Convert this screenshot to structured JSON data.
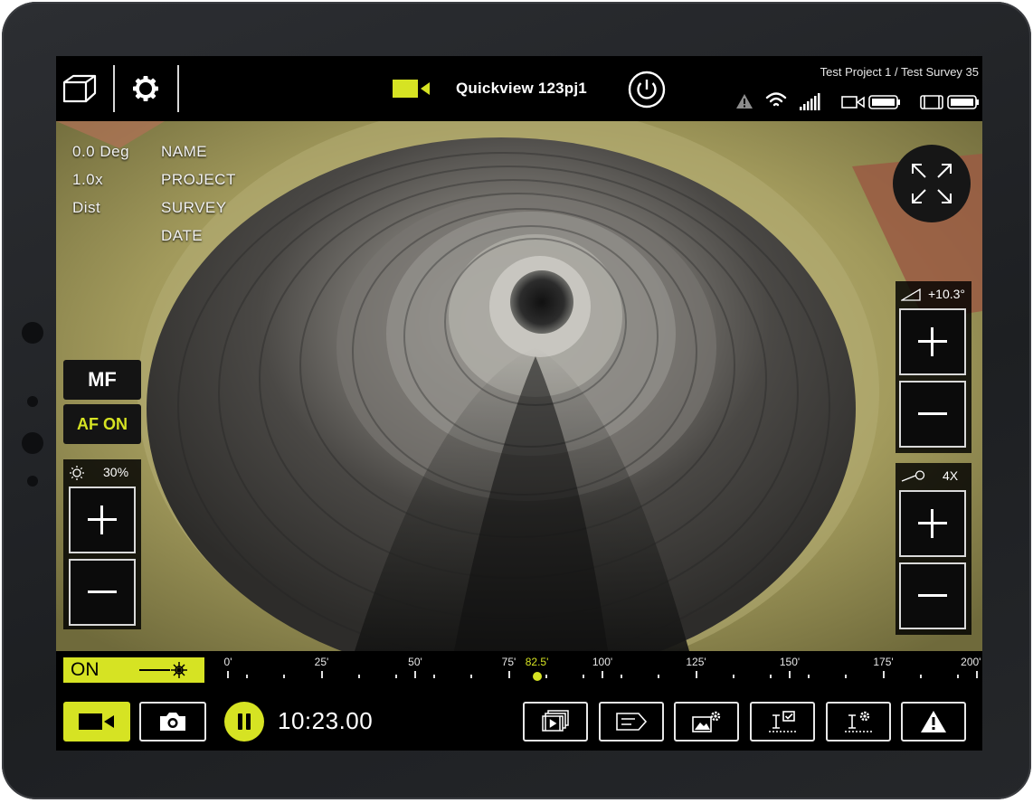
{
  "header": {
    "camera_name": "Quickview 123pj1",
    "project_path": "Test Project 1 / Test Survey 35"
  },
  "overlay": {
    "angle": "0.0 Deg",
    "zoom": "1.0x",
    "dist": "Dist",
    "fields": [
      "NAME",
      "PROJECT",
      "SURVEY",
      "DATE"
    ]
  },
  "focus": {
    "mf_label": "MF",
    "af_label": "AF ON"
  },
  "brightness": {
    "value": "30%"
  },
  "tilt": {
    "value": "+10.3°"
  },
  "zoom_control": {
    "value": "4X"
  },
  "laser": {
    "label": "ON"
  },
  "ruler": {
    "labels": [
      "0'",
      "25'",
      "50'",
      "75'",
      "100'",
      "125'",
      "150'",
      "175'",
      "200'"
    ],
    "current_label": "82.5'",
    "current_value": 82.5,
    "max_value": 200
  },
  "recording": {
    "timer": "10:23.00"
  },
  "colors": {
    "accent": "#d6e323",
    "bar_bg": "#000000"
  },
  "icons": {
    "top_left": [
      "package-icon",
      "settings-icon"
    ],
    "top_center": [
      "video-camera-icon",
      "power-icon"
    ],
    "status": [
      "warning-icon",
      "wifi-icon",
      "signal-icon",
      "camera-battery-icon",
      "tablet-battery-icon"
    ],
    "bottom": [
      "video-mode-icon",
      "photo-mode-icon",
      "pause-icon",
      "media-library-icon",
      "tag-icon",
      "image-settings-icon",
      "text-checklist-icon",
      "text-settings-icon",
      "alert-icon"
    ]
  }
}
